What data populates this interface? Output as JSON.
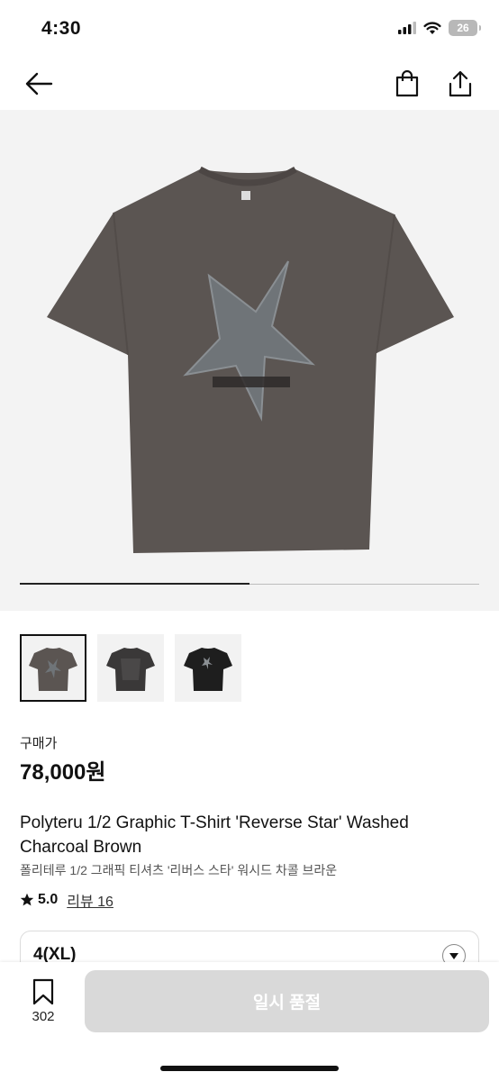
{
  "status_bar": {
    "time": "4:30",
    "battery": "26",
    "icons": [
      "signal-icon",
      "wifi-icon",
      "battery-icon"
    ]
  },
  "nav": {
    "icons": [
      "back-arrow-icon",
      "shopping-bag-icon",
      "share-icon"
    ]
  },
  "gallery": {
    "slide_progress": 0.5,
    "thumbnails": [
      {
        "name": "charcoal-brown-tshirt-front",
        "selected": true
      },
      {
        "name": "charcoal-tshirt-back"
      },
      {
        "name": "black-tshirt-front"
      }
    ]
  },
  "product": {
    "price_label": "구매가",
    "price": "78,000원",
    "title": "Polyteru 1/2 Graphic T-Shirt 'Reverse Star' Washed Charcoal Brown",
    "subtitle": "폴리테루 1/2 그래픽 티셔츠 '리버스 스타' 워시드 차콜 브라운",
    "rating": "5.0",
    "review_label": "리뷰 16"
  },
  "size_selector": {
    "selected": "4(XL)"
  },
  "bottom_bar": {
    "wish_count": "302",
    "status_button": "일시 품절"
  },
  "colors": {
    "accent": "#111111",
    "disabled_button": "#d9d9d9",
    "image_background": "#f3f3f3",
    "shirt": "#5b5552"
  }
}
